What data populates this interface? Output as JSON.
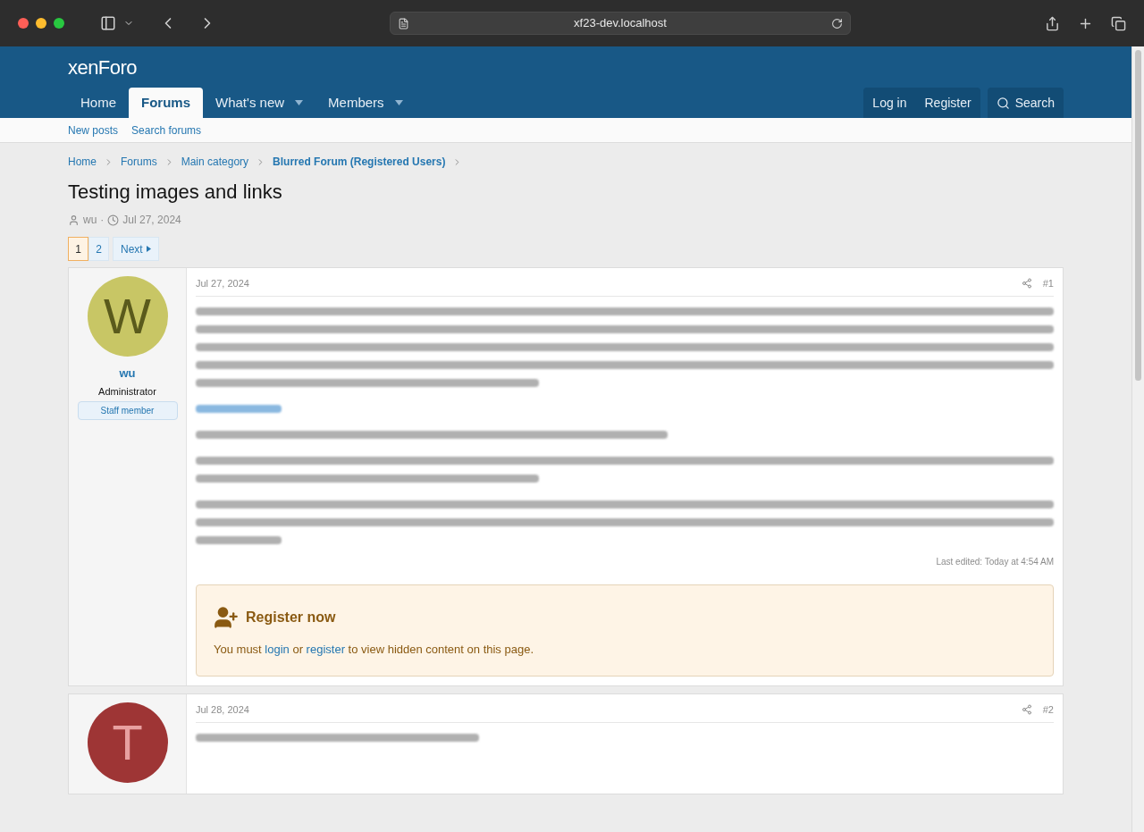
{
  "browser": {
    "url": "xf23-dev.localhost"
  },
  "header": {
    "logo": "xenForo",
    "nav": [
      {
        "label": "Home",
        "selected": false,
        "dropdown": false
      },
      {
        "label": "Forums",
        "selected": true,
        "dropdown": false
      },
      {
        "label": "What's new",
        "selected": false,
        "dropdown": true
      },
      {
        "label": "Members",
        "selected": false,
        "dropdown": true
      }
    ],
    "account": [
      "Log in",
      "Register"
    ],
    "search": "Search"
  },
  "subnav": [
    "New posts",
    "Search forums"
  ],
  "breadcrumbs": [
    {
      "label": "Home",
      "current": false
    },
    {
      "label": "Forums",
      "current": false
    },
    {
      "label": "Main category",
      "current": false
    },
    {
      "label": "Blurred Forum (Registered Users)",
      "current": true
    }
  ],
  "thread": {
    "title": "Testing images and links",
    "author": "wu",
    "separator": "·",
    "date": "Jul 27, 2024"
  },
  "pagination": {
    "pages": [
      {
        "label": "1",
        "selected": true
      },
      {
        "label": "2",
        "selected": false
      }
    ],
    "next": "Next"
  },
  "posts": [
    {
      "avatar_letter": "W",
      "color": "#c8c665",
      "username": "wu",
      "role": "Administrator",
      "badge": "Staff member",
      "date": "Jul 27, 2024",
      "number": "#1",
      "blocks": [
        {
          "kind": "paragraph5"
        },
        {
          "kind": "link"
        },
        {
          "kind": "line"
        },
        {
          "kind": "paragraph2"
        },
        {
          "kind": "paragraph3"
        }
      ],
      "edited": "Last edited: Today at 4:54 AM",
      "notice": {
        "title": "Register now",
        "parts": [
          {
            "kind": "text",
            "text": "You must "
          },
          {
            "kind": "link",
            "text": "login"
          },
          {
            "kind": "text",
            "text": " or "
          },
          {
            "kind": "link",
            "text": "register"
          },
          {
            "kind": "text",
            "text": " to view hidden content on this page."
          }
        ]
      }
    },
    {
      "avatar_letter": "T",
      "color": "#9e3535",
      "date": "Jul 28, 2024",
      "number": "#2",
      "blocks": [
        {
          "kind": "short_line"
        }
      ]
    }
  ]
}
